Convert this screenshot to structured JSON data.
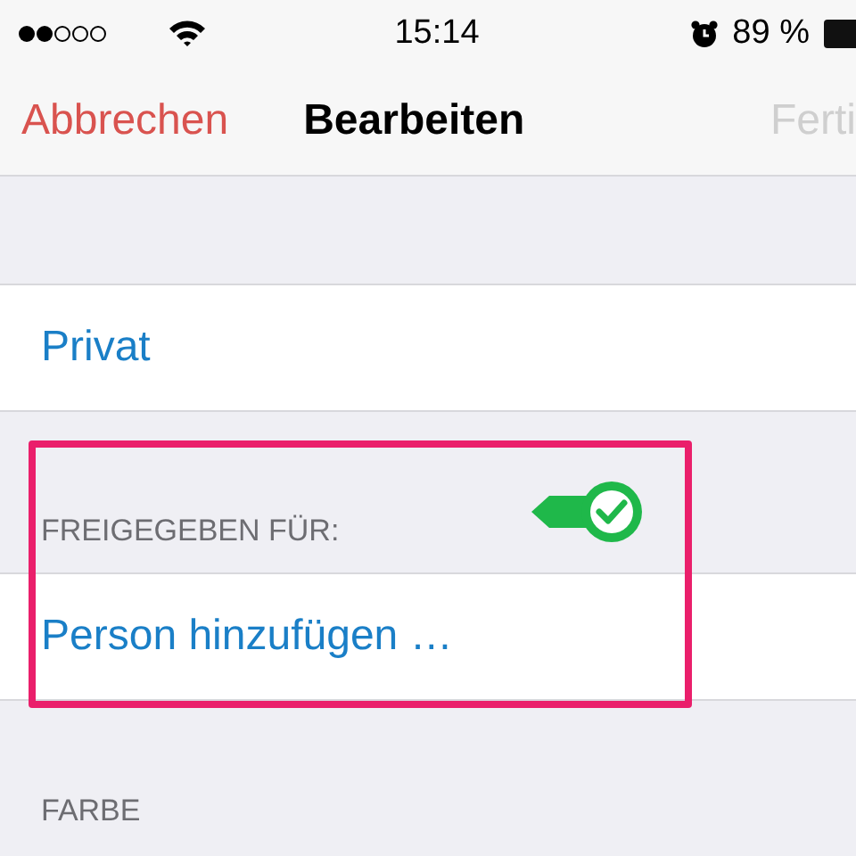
{
  "status_bar": {
    "time": "15:14",
    "battery_text": "89 %"
  },
  "nav": {
    "cancel": "Abbrechen",
    "title": "Bearbeiten",
    "done": {
      "label": "Ferti",
      "disabled": true
    }
  },
  "sections": [
    {
      "rows": [
        "Privat"
      ]
    },
    {
      "header": "FREIGEGEBEN FÜR:",
      "rows": [
        "Person hinzufügen …"
      ]
    },
    {
      "header": "FARBE"
    }
  ]
}
